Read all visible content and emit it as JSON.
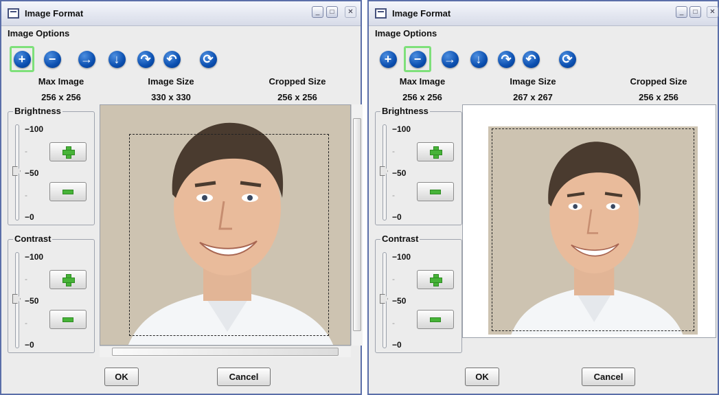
{
  "windows": [
    {
      "title": "Image Format",
      "menu_label": "Image Options",
      "selected_tool": "zoom-in",
      "headers": {
        "max_image": "Max Image",
        "image_size": "Image Size",
        "cropped_size": "Cropped Size"
      },
      "values": {
        "max_image": "256 x 256",
        "image_size": "330 x 330",
        "cropped_size": "256 x 256"
      },
      "brightness": {
        "label": "Brightness",
        "ticks": [
          "100",
          "-",
          "50",
          "-",
          "0"
        ],
        "value": 50
      },
      "contrast": {
        "label": "Contrast",
        "ticks": [
          "100",
          "-",
          "50",
          "-",
          "0"
        ],
        "value": 50
      },
      "buttons": {
        "ok": "OK",
        "cancel": "Cancel"
      }
    },
    {
      "title": "Image Format",
      "menu_label": "Image Options",
      "selected_tool": "zoom-out",
      "headers": {
        "max_image": "Max Image",
        "image_size": "Image Size",
        "cropped_size": "Cropped Size"
      },
      "values": {
        "max_image": "256 x 256",
        "image_size": "267 x 267",
        "cropped_size": "256 x 256"
      },
      "brightness": {
        "label": "Brightness",
        "ticks": [
          "100",
          "-",
          "50",
          "-",
          "0"
        ],
        "value": 50
      },
      "contrast": {
        "label": "Contrast",
        "ticks": [
          "100",
          "-",
          "50",
          "-",
          "0"
        ],
        "value": 50
      },
      "buttons": {
        "ok": "OK",
        "cancel": "Cancel"
      }
    }
  ],
  "toolbar_icons": [
    "zoom-in-icon",
    "zoom-out-icon",
    "arrow-right-icon",
    "arrow-down-icon",
    "rotate-right-icon",
    "rotate-left-icon",
    "refresh-icon"
  ],
  "colors": {
    "selected_highlight": "#7ee07a",
    "toolbar_blue": "#0b4fb0",
    "window_border": "#5a6ea8"
  }
}
